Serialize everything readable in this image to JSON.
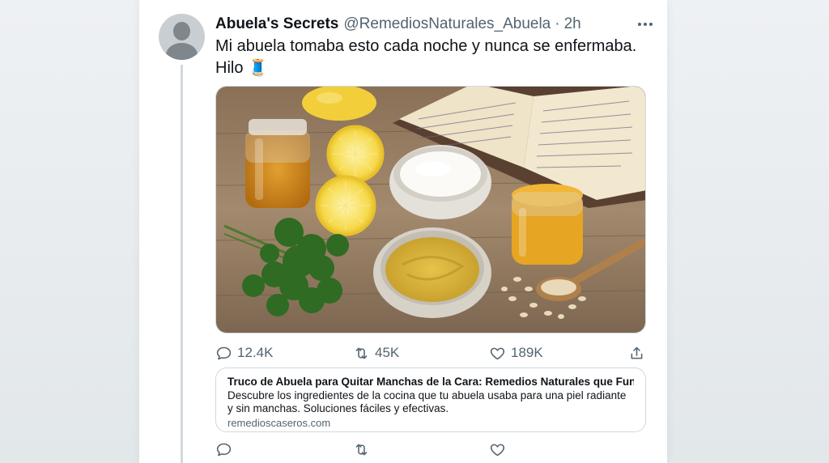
{
  "tweet": {
    "display_name": "Abuela's Secrets",
    "handle": "@RemediosNaturales_Abuela",
    "separator": "·",
    "time": "2h",
    "text": "Mi abuela tomaba esto cada noche y nunca se enfermaba. Hilo 🧵",
    "media_icon": "photo-of-natural-remedies"
  },
  "actions": {
    "replies": "12.4K",
    "retweets": "45K",
    "likes": "189K"
  },
  "link_card": {
    "title": "Truco de Abuela para Quitar Manchas de la Cara: Remedios Naturales que Funcionan",
    "description": "Descubre los ingredientes de la cocina que tu abuela usaba para una piel radiante y sin manchas. Soluciones fáciles y efectivas.",
    "domain": "remedioscaseros.com"
  },
  "colors": {
    "text_primary": "#0f1419",
    "text_secondary": "#536471",
    "border": "#cfd9de"
  }
}
